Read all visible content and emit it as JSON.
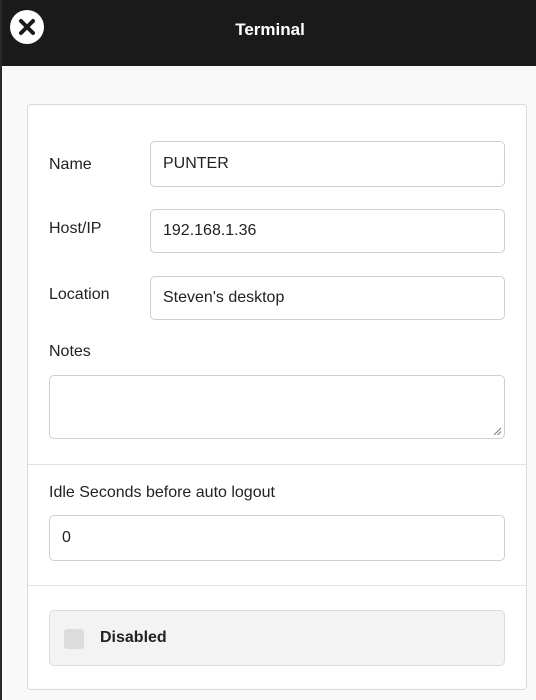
{
  "window": {
    "title": "Terminal"
  },
  "form": {
    "name_label": "Name",
    "name_value": "PUNTER",
    "host_label": "Host/IP",
    "host_value": "192.168.1.36",
    "location_label": "Location",
    "location_value": "Steven's desktop",
    "notes_label": "Notes",
    "notes_value": "",
    "idle_label": "Idle Seconds before auto logout",
    "idle_value": "0",
    "disabled_label": "Disabled",
    "disabled_checked": false
  },
  "icons": {
    "close": "close-icon",
    "resize": "resize-grip-icon"
  },
  "colors": {
    "titlebar": "#1a1a1a",
    "title_text": "#ffffff",
    "panel_bg": "#ffffff",
    "page_bg": "#f9f9f9"
  }
}
